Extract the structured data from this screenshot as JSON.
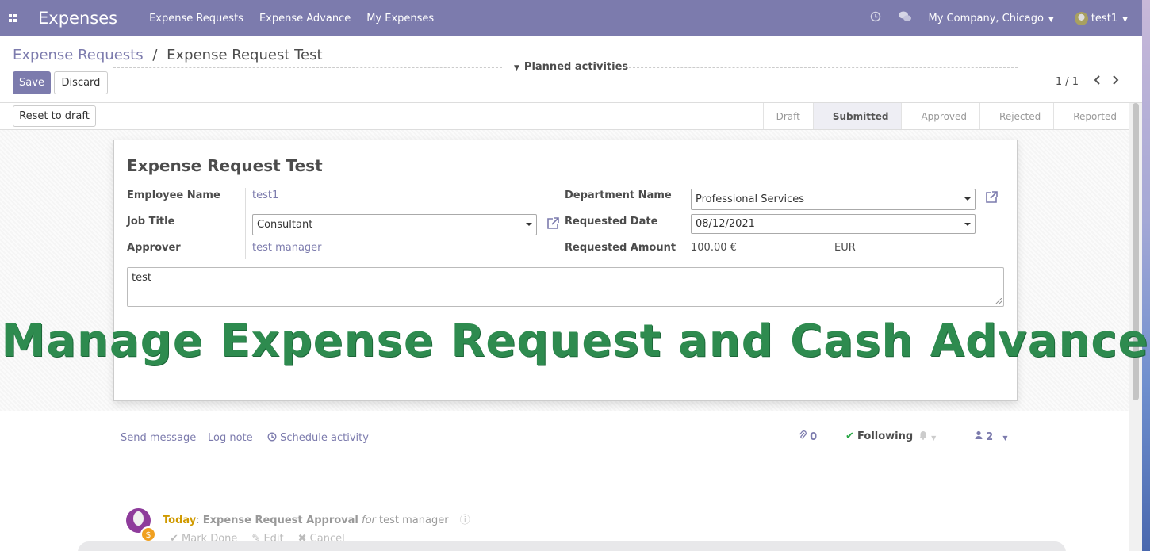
{
  "navbar": {
    "brand": "Expenses",
    "menu": [
      "Expense Requests",
      "Expense Advance",
      "My Expenses"
    ],
    "company": "My Company, Chicago",
    "user": "test1"
  },
  "control": {
    "breadcrumb_parent": "Expense Requests",
    "breadcrumb_sep": "/",
    "breadcrumb_current": "Expense Request Test",
    "save_label": "Save",
    "discard_label": "Discard",
    "pager": "1 / 1"
  },
  "statusbar": {
    "reset_label": "Reset to draft",
    "stages": [
      "Draft",
      "Submitted",
      "Approved",
      "Rejected",
      "Reported"
    ],
    "active_stage": "Submitted"
  },
  "form": {
    "title": "Expense Request Test",
    "employee_label": "Employee Name",
    "employee_value": "test1",
    "job_label": "Job Title",
    "job_value": "Consultant",
    "approver_label": "Approver",
    "approver_value": "test manager",
    "department_label": "Department Name",
    "department_value": "Professional Services",
    "date_label": "Requested Date",
    "date_value": "08/12/2021",
    "amount_label": "Requested Amount",
    "amount_value": "100.00 €",
    "currency_value": "EUR",
    "notes": "test"
  },
  "overlay_text": "Manage Expense Request and Cash Advance",
  "chatter": {
    "send_message": "Send message",
    "log_note": "Log note",
    "schedule_activity": "Schedule activity",
    "attachments_count": "0",
    "following": "Following",
    "followers_count": "2",
    "planned_label": "Planned activities",
    "activity": {
      "when": "Today",
      "type": "Expense Request Approval",
      "for": "for",
      "assignee": "test manager",
      "mark_done": "Mark Done",
      "edit": "Edit",
      "cancel": "Cancel"
    }
  },
  "colors": {
    "primary": "#7c7bad",
    "overlay": "#2e8b4f",
    "today": "#d09a00"
  }
}
